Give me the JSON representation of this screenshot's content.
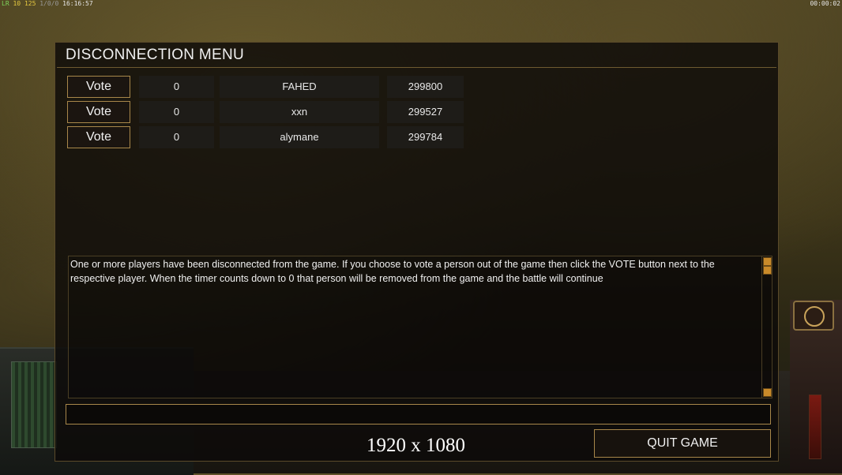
{
  "status": {
    "left_prefix": "LR",
    "left_fps": "10",
    "left_ping": "125",
    "left_dim": "1/0/0",
    "left_time": "16:16:57",
    "right_time": "00:00:02"
  },
  "dialog": {
    "title": "DISCONNECTION MENU",
    "players": [
      {
        "vote_label": "Vote",
        "count": "0",
        "name": "FAHED",
        "id": "299800"
      },
      {
        "vote_label": "Vote",
        "count": "0",
        "name": "xxn",
        "id": "299527"
      },
      {
        "vote_label": "Vote",
        "count": "0",
        "name": "alymane",
        "id": "299784"
      }
    ],
    "message": "One or more players have been disconnected from the game. If you choose to vote a person out of the game then click the VOTE button next to the respective player. When the timer counts down to 0 that person will be removed from the game and the battle will continue",
    "chat_value": "",
    "quit_label": "QUIT GAME"
  },
  "caption": "1920 x 1080"
}
